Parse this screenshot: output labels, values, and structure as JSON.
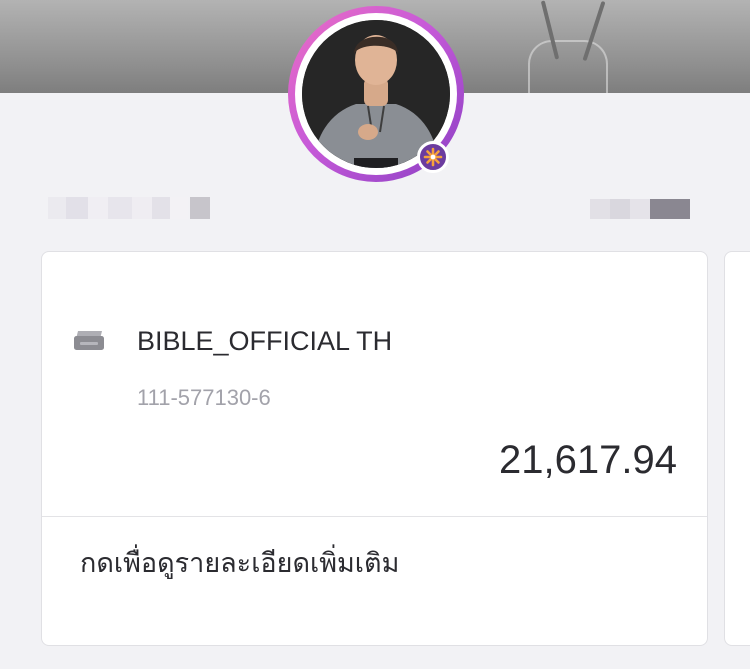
{
  "account_card": {
    "account_name": "BIBLE_OFFICIAL TH",
    "account_number": "111-577130-6",
    "balance": "21,617.94",
    "details_link_label": "กดเพื่อดูรายละเอียดเพิ่มเติม",
    "icon": "bank-card-icon"
  },
  "profile": {
    "avatar_icon": "profile-photo",
    "badge_icon": "sparkle-badge-icon"
  },
  "colors": {
    "background": "#f2f2f5",
    "card_background": "#ffffff",
    "avatar_ring_start": "#ec6ec3",
    "avatar_ring_end": "#8b3fc4",
    "badge": "#6c3c9f",
    "primary_text": "#2b2b30",
    "secondary_text": "#a2a2aa"
  }
}
